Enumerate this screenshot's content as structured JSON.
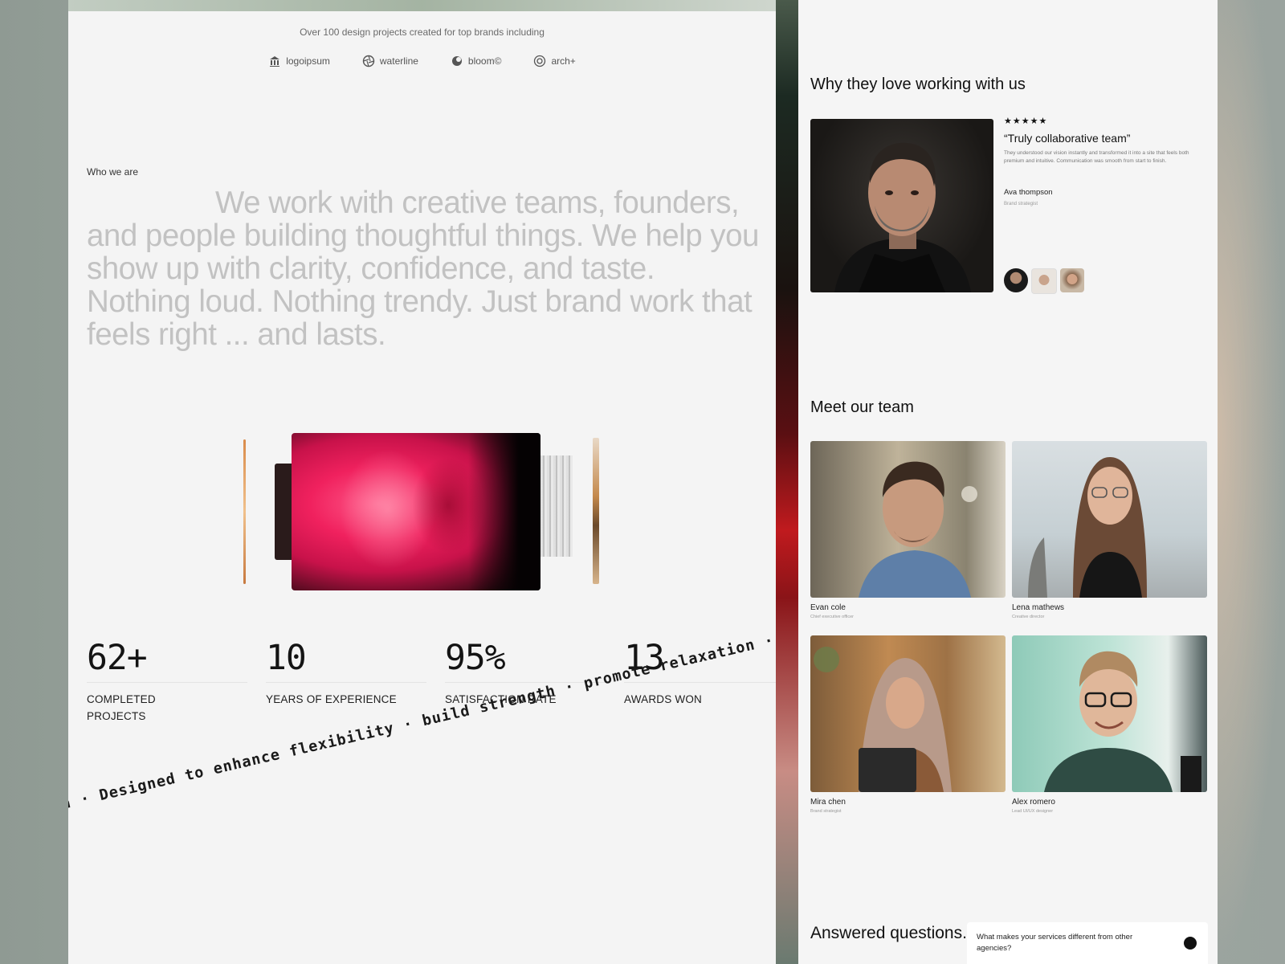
{
  "brands": {
    "caption": "Over 100 design projects created for top brands including",
    "logos": [
      {
        "name": "logoipsum",
        "icon": "columns-logo-icon"
      },
      {
        "name": "waterline",
        "icon": "aperture-logo-icon"
      },
      {
        "name": "bloom©",
        "icon": "bloom-logo-icon"
      },
      {
        "name": "arch+",
        "icon": "target-logo-icon"
      }
    ]
  },
  "about": {
    "label": "Who we are",
    "mission": "We work with creative teams, founders, and people building thoughtful things. We help you show up with clarity, confidence, and taste. Nothing loud. Nothing trendy. Just brand work that feels right ... and lasts."
  },
  "stats": [
    {
      "value": "62+",
      "label": "COMPLETED PROJECTS"
    },
    {
      "value": "10",
      "label": "YEARS OF EXPERIENCE"
    },
    {
      "value": "95%",
      "label": "SATISFACTION RATE"
    },
    {
      "value": "13",
      "label": "AWARDS WON"
    }
  ],
  "marquee": {
    "text": "on · Designed to enhance flexibility · build strength · promote relaxation · Design"
  },
  "testimonials": {
    "title": "Why they love working with us",
    "stars": "★★★★★",
    "quote": "“Truly collaborative team”",
    "body": "They understood our vision instantly and transformed it into a site that feels both premium and intuitive. Communication was smooth from start to finish.",
    "author": "Ava thompson",
    "role": "Brand strategist"
  },
  "team": {
    "title": "Meet our team",
    "members": [
      {
        "name": "Evan cole",
        "role": "Chief executive officer"
      },
      {
        "name": "Lena mathews",
        "role": "Creative director"
      },
      {
        "name": "Mira chen",
        "role": "Brand strategist"
      },
      {
        "name": "Alex romero",
        "role": "Lead UI/UX designer"
      }
    ]
  },
  "faq": {
    "title": "Answered questions.",
    "question": "What makes your services different from other agencies?"
  }
}
